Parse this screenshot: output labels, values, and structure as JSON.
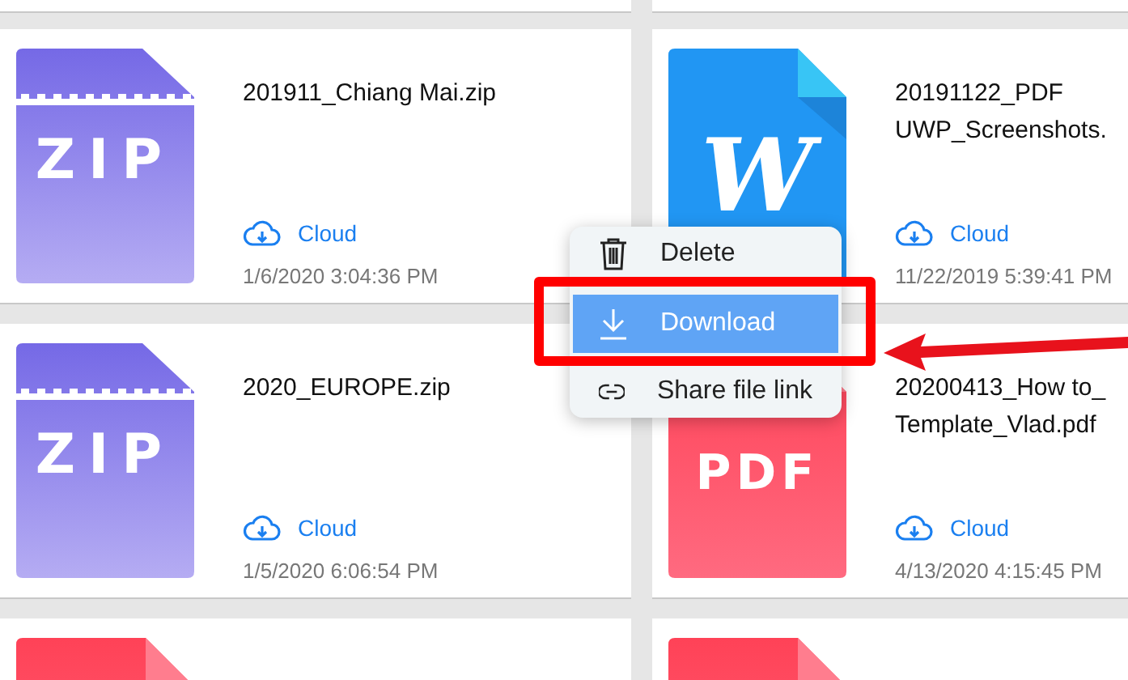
{
  "files": [
    {
      "kind": "zip",
      "icon_label": "ZIP",
      "name_lines": [
        "201911_Chiang Mai.zip"
      ],
      "location": "Cloud",
      "date": "1/6/2020 3:04:36 PM"
    },
    {
      "kind": "docx",
      "icon_label": "W",
      "name_lines": [
        "20191122_PDF",
        "UWP_Screenshots."
      ],
      "location": "Cloud",
      "date": "11/22/2019 5:39:41 PM"
    },
    {
      "kind": "zip",
      "icon_label": "ZIP",
      "name_lines": [
        "2020_EUROPE.zip"
      ],
      "location": "Cloud",
      "date": "1/5/2020 6:06:54 PM"
    },
    {
      "kind": "pdf",
      "icon_label": "PDF",
      "name_lines": [
        "20200413_How to_",
        "Template_Vlad.pdf"
      ],
      "location": "Cloud",
      "date": "4/13/2020 4:15:45 PM"
    }
  ],
  "partial_files": [
    {
      "kind": "pdf"
    },
    {
      "kind": "pdf"
    }
  ],
  "context_menu": {
    "items": [
      {
        "kind": "delete",
        "label": "Delete",
        "selected": false
      },
      {
        "kind": "download",
        "label": "Download",
        "selected": true
      },
      {
        "kind": "link",
        "label": "Share file link",
        "selected": false
      }
    ]
  }
}
